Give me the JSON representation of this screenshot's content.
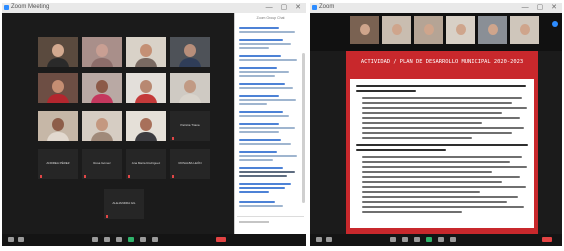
{
  "left_window": {
    "title": "Zoom Meeting",
    "name_tiles": [
      {
        "label": "ANDREA PÉREZ"
      },
      {
        "label": "Rosa Gómez"
      },
      {
        "label": "Ana María Rodríguez"
      },
      {
        "label": "ROSALBA LEÓN"
      },
      {
        "label": "ALEJANDRA GIL"
      }
    ],
    "video_tile_after_name": {
      "label": "Patricia Triana"
    },
    "chat": {
      "title": "Zoom Group Chat"
    }
  },
  "right_window": {
    "title": "Zoom",
    "slide": {
      "title": "ACTIVIDAD / PLAN DE DESARROLLO MUNICIPAL 2020-2023"
    }
  },
  "colors": {
    "slide_red": "#c8282c",
    "zoom_blue": "#2d8cff",
    "end_red": "#e24343"
  }
}
